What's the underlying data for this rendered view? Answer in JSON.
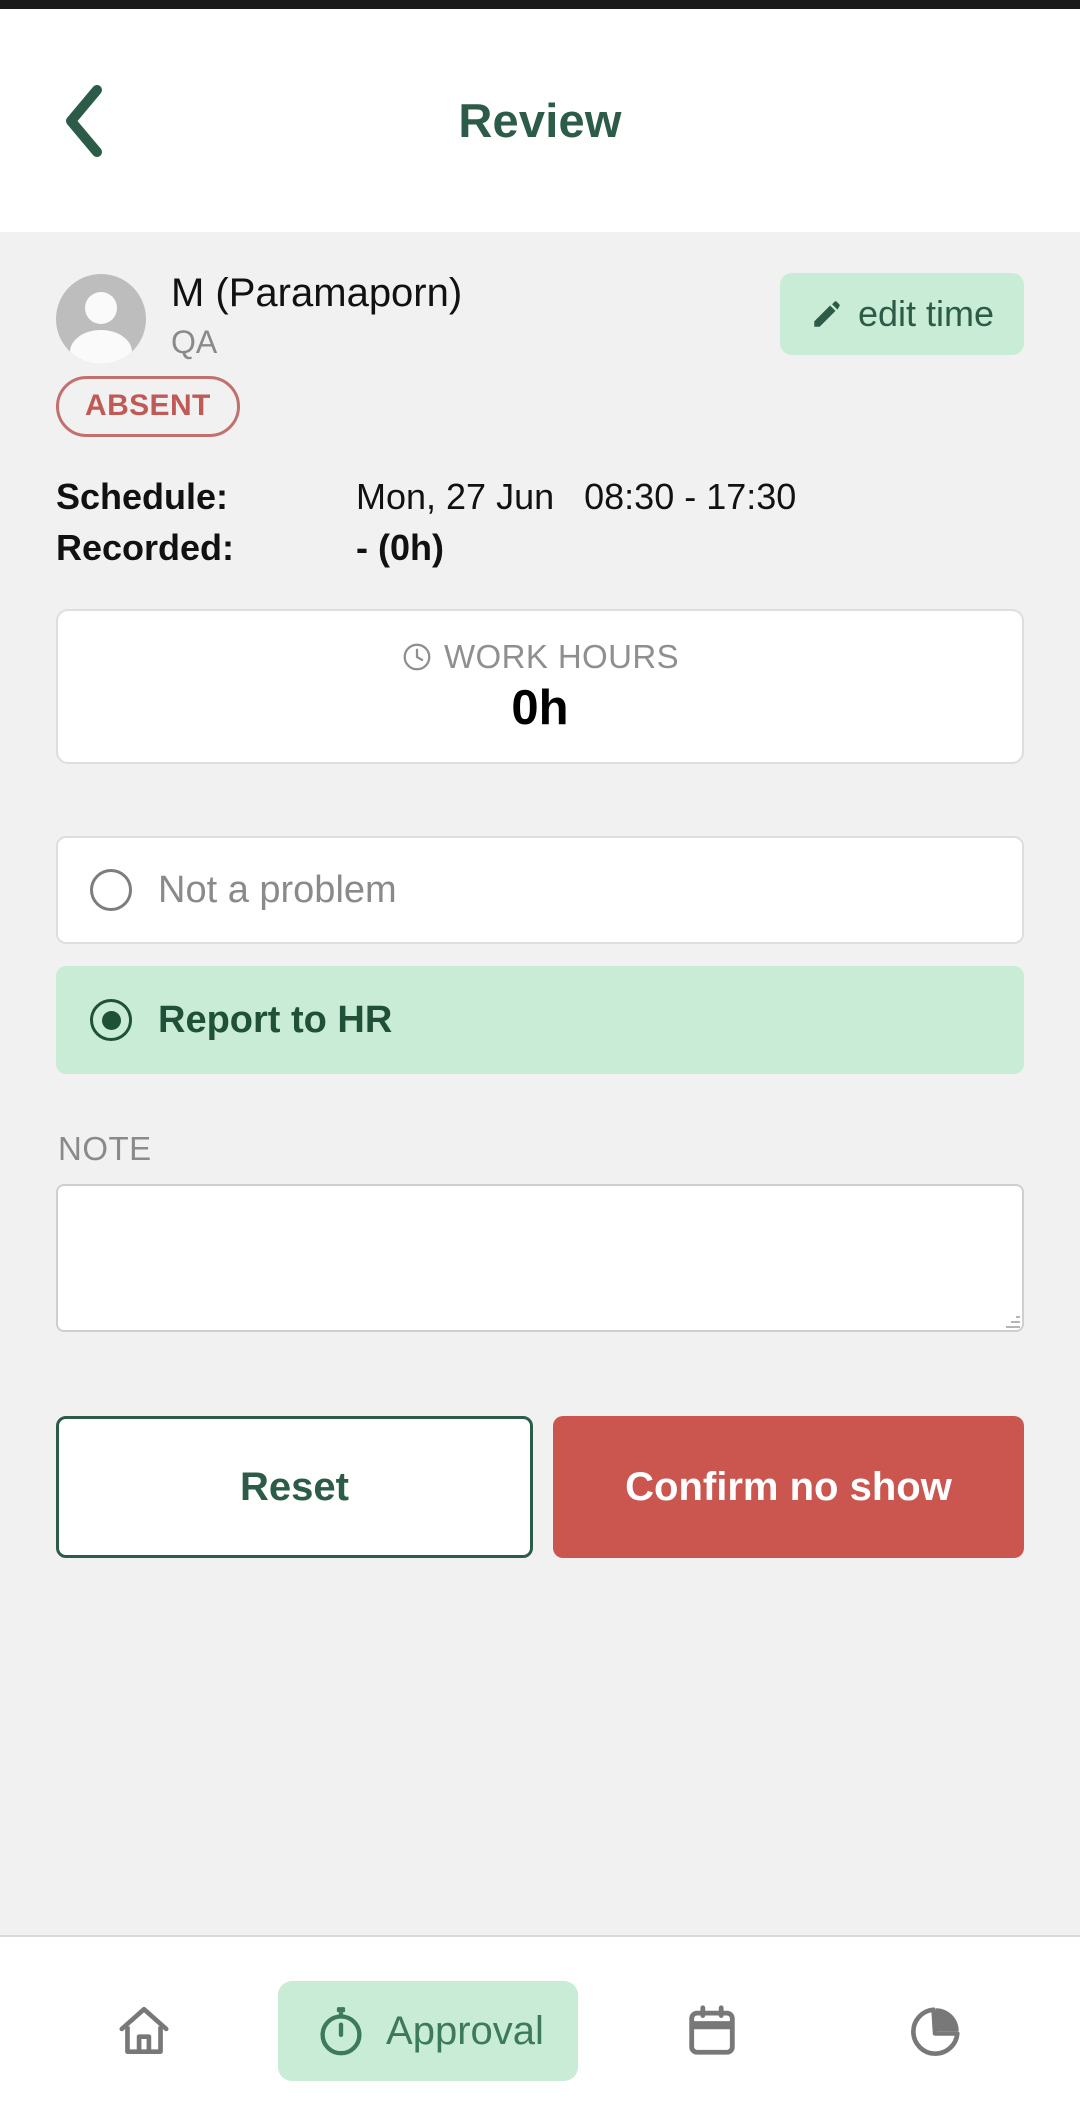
{
  "header": {
    "title": "Review",
    "back_icon": "chevron-left-icon",
    "accent_color": "#2c5c47"
  },
  "person": {
    "avatar_icon": "user-avatar-icon",
    "name": "M (Paramaporn)",
    "role": "QA",
    "status_badge": "ABSENT",
    "status_color": "#bf5a57",
    "edit_time": {
      "label": "edit time",
      "icon": "pencil-icon",
      "background": "#c8ecd6"
    }
  },
  "info": {
    "schedule_label": "Schedule:",
    "schedule_date": "Mon, 27 Jun",
    "schedule_time": "08:30 - 17:30",
    "recorded_label": "Recorded:",
    "recorded_value": "-  (0h)"
  },
  "work_hours": {
    "icon": "clock-icon",
    "label": "WORK HOURS",
    "value": "0h"
  },
  "options": [
    {
      "label": "Not a problem",
      "selected": false
    },
    {
      "label": "Report to HR",
      "selected": true
    }
  ],
  "note": {
    "label": "NOTE",
    "value": "",
    "placeholder": ""
  },
  "actions": {
    "reset_label": "Reset",
    "confirm_label": "Confirm no show",
    "confirm_color": "#cb5650"
  },
  "bottom_nav": [
    {
      "icon": "home-icon",
      "label": "",
      "active": false
    },
    {
      "icon": "stopwatch-icon",
      "label": "Approval",
      "active": true
    },
    {
      "icon": "calendar-icon",
      "label": "",
      "active": false
    },
    {
      "icon": "pie-chart-icon",
      "label": "",
      "active": false
    }
  ]
}
